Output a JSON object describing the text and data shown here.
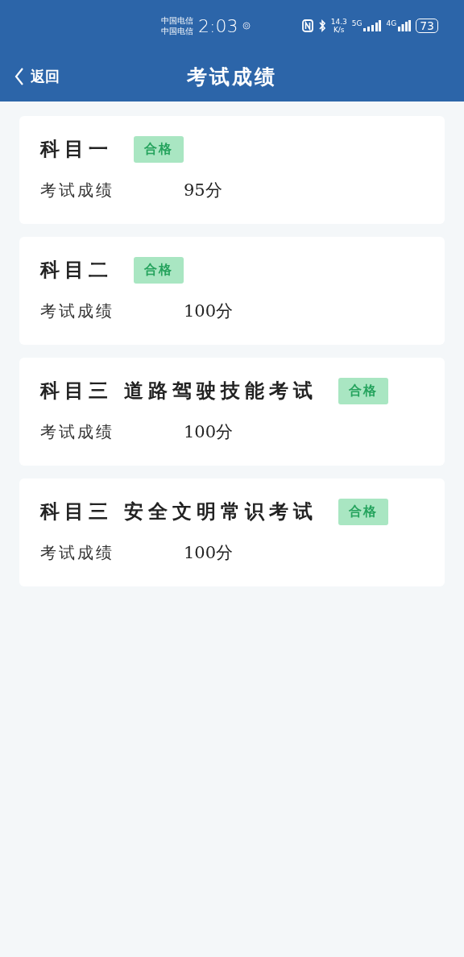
{
  "status_bar": {
    "carriers": [
      "中国电信",
      "中国电信"
    ],
    "time": "2:03",
    "speed": [
      "14.3",
      "K/s"
    ],
    "network_5g": "5G",
    "network_4g": "4G",
    "battery": "73"
  },
  "header": {
    "back": "返回",
    "title": "考试成绩"
  },
  "results": [
    {
      "subject": "科目一",
      "tag": "合格",
      "label": "考试成绩",
      "score": "95分"
    },
    {
      "subject": "科目二",
      "tag": "合格",
      "label": "考试成绩",
      "score": "100分"
    },
    {
      "subject": "科目三 道路驾驶技能考试",
      "tag": "合格",
      "label": "考试成绩",
      "score": "100分"
    },
    {
      "subject": "科目三 安全文明常识考试",
      "tag": "合格",
      "label": "考试成绩",
      "score": "100分"
    }
  ]
}
